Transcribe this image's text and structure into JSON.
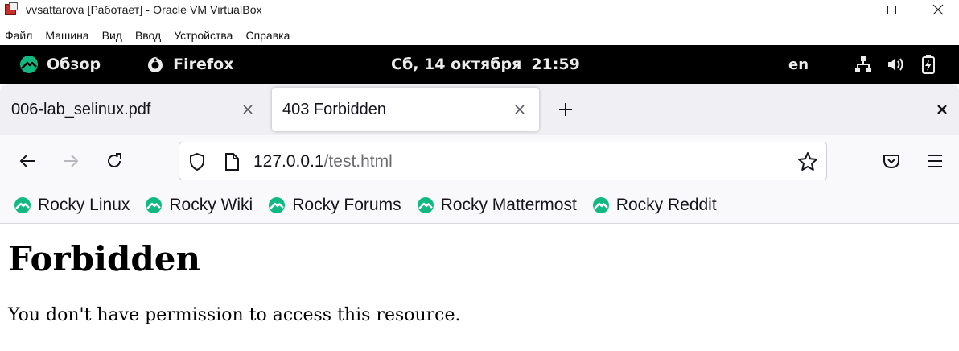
{
  "host_window": {
    "title": "vvsattarova [Работает] - Oracle VM VirtualBox",
    "menu": [
      "Файл",
      "Машина",
      "Вид",
      "Ввод",
      "Устройства",
      "Справка"
    ]
  },
  "gnome_bar": {
    "overview_label": "Обзор",
    "app_label": "Firefox",
    "date": "Сб, 14 октября",
    "time": "21:59",
    "lang": "en"
  },
  "browser": {
    "tabs": [
      {
        "title": "006-lab_selinux.pdf",
        "active": false
      },
      {
        "title": "403 Forbidden",
        "active": true
      }
    ],
    "url": {
      "host": "127.0.0.1",
      "path": "/test.html"
    },
    "bookmarks": [
      "Rocky Linux",
      "Rocky Wiki",
      "Rocky Forums",
      "Rocky Mattermost",
      "Rocky Reddit"
    ]
  },
  "page": {
    "heading": "Forbidden",
    "message": "You don't have permission to access this resource."
  },
  "colors": {
    "gnome_bar_bg": "#000000",
    "tabstrip_bg": "#f0f0f4",
    "rocky_green": "#10b981"
  }
}
